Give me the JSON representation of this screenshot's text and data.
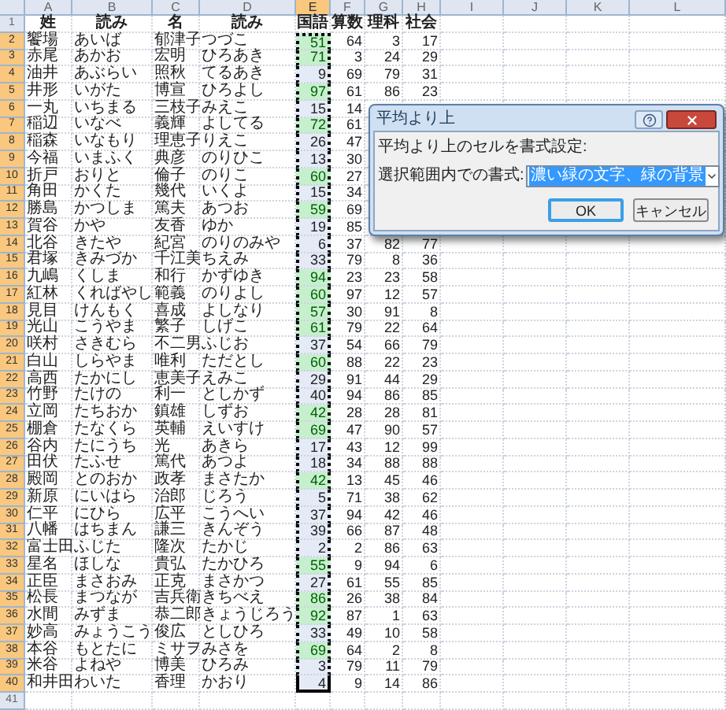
{
  "columns": [
    {
      "letter": "A",
      "selected": false
    },
    {
      "letter": "B",
      "selected": false
    },
    {
      "letter": "C",
      "selected": false
    },
    {
      "letter": "D",
      "selected": false
    },
    {
      "letter": "E",
      "selected": true
    },
    {
      "letter": "F",
      "selected": false
    },
    {
      "letter": "G",
      "selected": false
    },
    {
      "letter": "H",
      "selected": false
    },
    {
      "letter": "I",
      "selected": false
    },
    {
      "letter": "J",
      "selected": false
    },
    {
      "letter": "K",
      "selected": false
    },
    {
      "letter": "L",
      "selected": false
    }
  ],
  "rows": [
    {
      "number": "1",
      "selected": false,
      "cells": [
        "姓",
        "読み",
        "名",
        "読み",
        "国語",
        "算数",
        "理科",
        "社会"
      ]
    },
    {
      "number": "2",
      "selected": true,
      "highlighted": true,
      "cells": [
        "饗場",
        "あいば",
        "郁津子",
        "つづこ",
        "51",
        "64",
        "3",
        "17"
      ]
    },
    {
      "number": "3",
      "selected": true,
      "highlighted": true,
      "cells": [
        "赤尾",
        "あかお",
        "宏明",
        "ひろあき",
        "71",
        "3",
        "24",
        "29"
      ]
    },
    {
      "number": "4",
      "selected": true,
      "highlighted": false,
      "cells": [
        "油井",
        "あぶらい",
        "照秋",
        "てるあき",
        "9",
        "69",
        "79",
        "31"
      ]
    },
    {
      "number": "5",
      "selected": true,
      "highlighted": true,
      "cells": [
        "井形",
        "いがた",
        "博宣",
        "ひろよし",
        "97",
        "61",
        "86",
        "23"
      ]
    },
    {
      "number": "6",
      "selected": true,
      "highlighted": false,
      "cells": [
        "一丸",
        "いちまる",
        "三枝子",
        "みえこ",
        "15",
        "14"
      ]
    },
    {
      "number": "7",
      "selected": true,
      "highlighted": true,
      "cells": [
        "稲辺",
        "いなべ",
        "義輝",
        "よしてる",
        "72",
        "61"
      ]
    },
    {
      "number": "8",
      "selected": true,
      "highlighted": false,
      "cells": [
        "稲森",
        "いなもり",
        "理恵子",
        "りえこ",
        "26",
        "47"
      ]
    },
    {
      "number": "9",
      "selected": true,
      "highlighted": false,
      "cells": [
        "今福",
        "いまふく",
        "典彦",
        "のりひこ",
        "13",
        "30"
      ]
    },
    {
      "number": "10",
      "selected": true,
      "highlighted": true,
      "cells": [
        "折戸",
        "おりと",
        "倫子",
        "のりこ",
        "60",
        "27"
      ]
    },
    {
      "number": "11",
      "selected": true,
      "highlighted": false,
      "cells": [
        "角田",
        "かくた",
        "幾代",
        "いくよ",
        "15",
        "34"
      ]
    },
    {
      "number": "12",
      "selected": true,
      "highlighted": true,
      "cells": [
        "勝島",
        "かつしま",
        "篤夫",
        "あつお",
        "59",
        "69"
      ]
    },
    {
      "number": "13",
      "selected": true,
      "highlighted": false,
      "cells": [
        "賀谷",
        "かや",
        "友香",
        "ゆか",
        "19",
        "85"
      ]
    },
    {
      "number": "14",
      "selected": true,
      "highlighted": false,
      "cells": [
        "北谷",
        "きたや",
        "紀宮",
        "のりのみや",
        "6",
        "37",
        "82",
        "77"
      ]
    },
    {
      "number": "15",
      "selected": true,
      "highlighted": false,
      "cells": [
        "君塚",
        "きみづか",
        "千江美",
        "ちえみ",
        "33",
        "79",
        "8",
        "36"
      ]
    },
    {
      "number": "16",
      "selected": true,
      "highlighted": true,
      "cells": [
        "九嶋",
        "くしま",
        "和行",
        "かずゆき",
        "94",
        "23",
        "23",
        "58"
      ]
    },
    {
      "number": "17",
      "selected": true,
      "highlighted": true,
      "cells": [
        "紅林",
        "くればやし",
        "範義",
        "のりよし",
        "60",
        "97",
        "12",
        "57"
      ]
    },
    {
      "number": "18",
      "selected": true,
      "highlighted": true,
      "cells": [
        "見目",
        "けんもく",
        "喜成",
        "よしなり",
        "57",
        "30",
        "91",
        "8"
      ]
    },
    {
      "number": "19",
      "selected": true,
      "highlighted": true,
      "cells": [
        "光山",
        "こうやま",
        "繁子",
        "しげこ",
        "61",
        "79",
        "22",
        "64"
      ]
    },
    {
      "number": "20",
      "selected": true,
      "highlighted": false,
      "cells": [
        "咲村",
        "さきむら",
        "不二男",
        "ふじお",
        "37",
        "54",
        "66",
        "79"
      ]
    },
    {
      "number": "21",
      "selected": true,
      "highlighted": true,
      "cells": [
        "白山",
        "しらやま",
        "唯利",
        "ただとし",
        "60",
        "88",
        "22",
        "23"
      ]
    },
    {
      "number": "22",
      "selected": true,
      "highlighted": false,
      "cells": [
        "高西",
        "たかにし",
        "恵美子",
        "えみこ",
        "29",
        "91",
        "44",
        "29"
      ]
    },
    {
      "number": "23",
      "selected": true,
      "highlighted": false,
      "cells": [
        "竹野",
        "たけの",
        "利一",
        "としかず",
        "40",
        "94",
        "86",
        "85"
      ]
    },
    {
      "number": "24",
      "selected": true,
      "highlighted": true,
      "cells": [
        "立岡",
        "たちおか",
        "鎮雄",
        "しずお",
        "42",
        "28",
        "28",
        "81"
      ]
    },
    {
      "number": "25",
      "selected": true,
      "highlighted": true,
      "cells": [
        "棚倉",
        "たなくら",
        "英輔",
        "えいすけ",
        "69",
        "47",
        "90",
        "57"
      ]
    },
    {
      "number": "26",
      "selected": true,
      "highlighted": false,
      "cells": [
        "谷内",
        "たにうち",
        "光",
        "あきら",
        "17",
        "43",
        "12",
        "99"
      ]
    },
    {
      "number": "27",
      "selected": true,
      "highlighted": false,
      "cells": [
        "田伏",
        "たふせ",
        "篤代",
        "あつよ",
        "18",
        "34",
        "88",
        "88"
      ]
    },
    {
      "number": "28",
      "selected": true,
      "highlighted": true,
      "cells": [
        "殿岡",
        "とのおか",
        "政孝",
        "まさたか",
        "42",
        "13",
        "45",
        "46"
      ]
    },
    {
      "number": "29",
      "selected": true,
      "highlighted": false,
      "cells": [
        "新原",
        "にいはら",
        "治郎",
        "じろう",
        "5",
        "71",
        "38",
        "62"
      ]
    },
    {
      "number": "30",
      "selected": true,
      "highlighted": false,
      "cells": [
        "仁平",
        "にひら",
        "広平",
        "こうへい",
        "37",
        "94",
        "42",
        "46"
      ]
    },
    {
      "number": "31",
      "selected": true,
      "highlighted": false,
      "cells": [
        "八幡",
        "はちまん",
        "謙三",
        "きんぞう",
        "39",
        "66",
        "87",
        "48"
      ]
    },
    {
      "number": "32",
      "selected": true,
      "highlighted": false,
      "cells": [
        "富士田",
        "ふじた",
        "隆次",
        "たかじ",
        "2",
        "2",
        "86",
        "63"
      ]
    },
    {
      "number": "33",
      "selected": true,
      "highlighted": true,
      "cells": [
        "星名",
        "ほしな",
        "貴弘",
        "たかひろ",
        "55",
        "9",
        "94",
        "6"
      ]
    },
    {
      "number": "34",
      "selected": true,
      "highlighted": false,
      "cells": [
        "正臣",
        "まさおみ",
        "正克",
        "まさかつ",
        "27",
        "61",
        "55",
        "85"
      ]
    },
    {
      "number": "35",
      "selected": true,
      "highlighted": true,
      "cells": [
        "松長",
        "まつなが",
        "吉兵衛",
        "きちべえ",
        "86",
        "26",
        "38",
        "84"
      ]
    },
    {
      "number": "36",
      "selected": true,
      "highlighted": true,
      "cells": [
        "水間",
        "みずま",
        "恭二郎",
        "きょうじろう",
        "92",
        "87",
        "1",
        "63"
      ]
    },
    {
      "number": "37",
      "selected": true,
      "highlighted": false,
      "cells": [
        "妙高",
        "みょうこう",
        "俊広",
        "としひろ",
        "33",
        "49",
        "10",
        "58"
      ]
    },
    {
      "number": "38",
      "selected": true,
      "highlighted": true,
      "cells": [
        "本谷",
        "もとたに",
        "ミサヲ",
        "みさを",
        "69",
        "64",
        "2",
        "8"
      ]
    },
    {
      "number": "39",
      "selected": true,
      "highlighted": false,
      "cells": [
        "米谷",
        "よねや",
        "博美",
        "ひろみ",
        "3",
        "79",
        "11",
        "79"
      ]
    },
    {
      "number": "40",
      "selected": true,
      "highlighted": false,
      "cells": [
        "和井田",
        "わいた",
        "香理",
        "かおり",
        "4",
        "9",
        "14",
        "86"
      ]
    },
    {
      "number": "41",
      "selected": false
    }
  ],
  "dialog": {
    "title": "平均より上",
    "prompt": "平均より上のセルを書式設定:",
    "format_label": "選択範囲内での書式:",
    "format_value": "濃い緑の文字、緑の背景",
    "buttons": [
      {
        "label": "OK",
        "default": true
      },
      {
        "label": "キャンセル",
        "default": false
      }
    ]
  }
}
